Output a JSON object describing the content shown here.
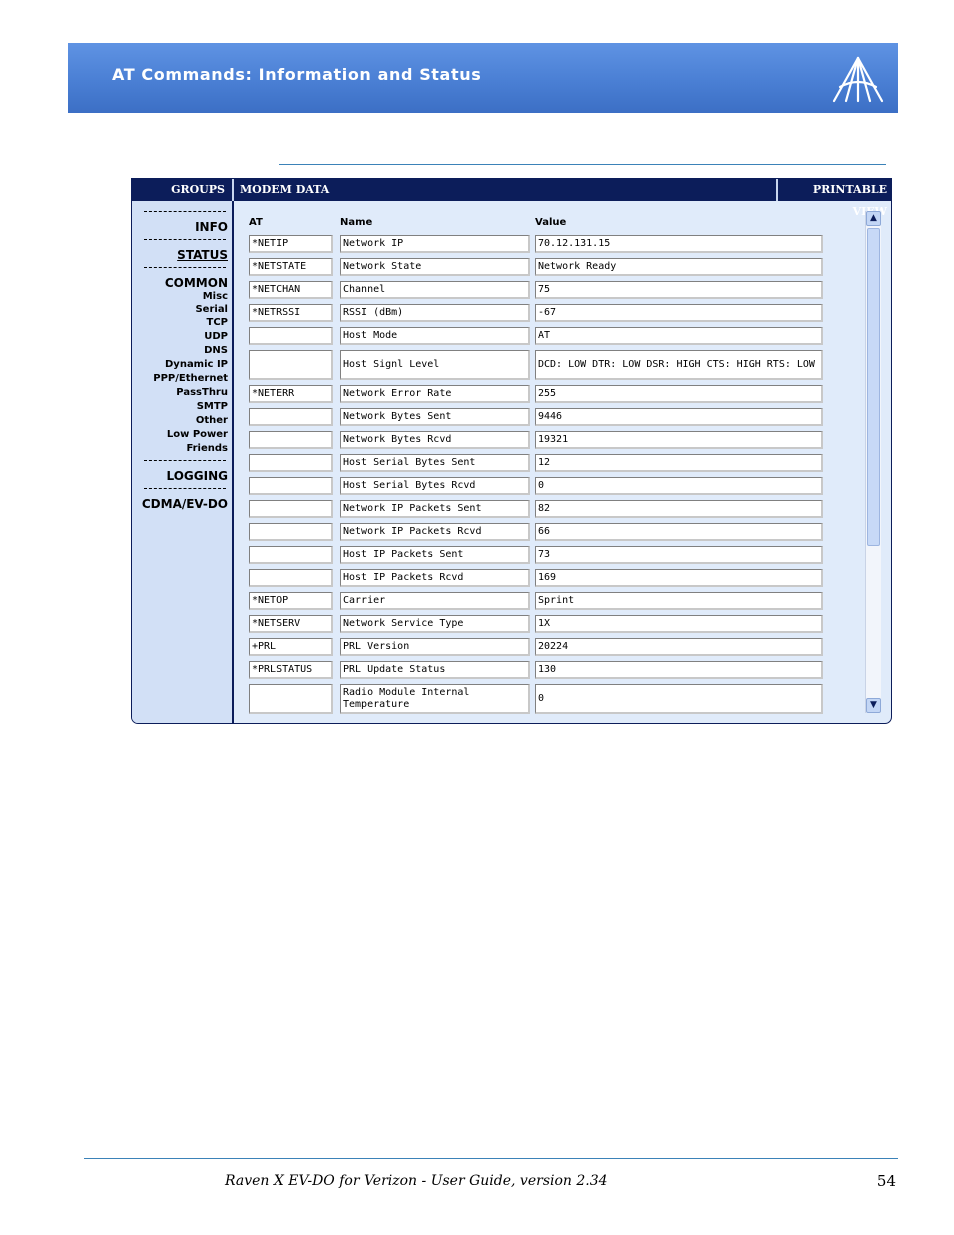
{
  "header": {
    "title": "AT Commands: Information and Status"
  },
  "topbar": {
    "groups": "GROUPS",
    "modem_data": "MODEM DATA",
    "printable_view": "PRINTABLE VIEW"
  },
  "sidebar": {
    "separator": "--------------",
    "items": [
      {
        "label": "INFO",
        "kind": "group"
      },
      {
        "label": "STATUS",
        "kind": "group-active"
      },
      {
        "label": "COMMON",
        "kind": "group"
      },
      {
        "label": "Misc",
        "kind": "sub"
      },
      {
        "label": "Serial",
        "kind": "sub"
      },
      {
        "label": "TCP",
        "kind": "sub"
      },
      {
        "label": "UDP",
        "kind": "sub"
      },
      {
        "label": "DNS",
        "kind": "sub"
      },
      {
        "label": "Dynamic IP",
        "kind": "sub"
      },
      {
        "label": "PPP/Ethernet",
        "kind": "sub"
      },
      {
        "label": "PassThru",
        "kind": "sub"
      },
      {
        "label": "SMTP",
        "kind": "sub"
      },
      {
        "label": "Other",
        "kind": "sub"
      },
      {
        "label": "Low Power",
        "kind": "sub"
      },
      {
        "label": "Friends",
        "kind": "sub"
      },
      {
        "label": "LOGGING",
        "kind": "group"
      },
      {
        "label": "CDMA/EV-DO",
        "kind": "group"
      }
    ]
  },
  "table": {
    "columns": [
      "AT",
      "Name",
      "Value"
    ],
    "rows": [
      {
        "at": "*NETIP",
        "name": "Network IP",
        "value": "70.12.131.15"
      },
      {
        "at": "*NETSTATE",
        "name": "Network State",
        "value": "Network Ready"
      },
      {
        "at": "*NETCHAN",
        "name": "Channel",
        "value": "75"
      },
      {
        "at": "*NETRSSI",
        "name": "RSSI (dBm)",
        "value": "-67"
      },
      {
        "at": "",
        "name": "Host Mode",
        "value": "AT"
      },
      {
        "at": "",
        "name": "Host Signl Level",
        "value": "DCD: LOW DTR: LOW DSR: HIGH CTS: HIGH RTS: LOW"
      },
      {
        "at": "*NETERR",
        "name": "Network Error Rate",
        "value": "255"
      },
      {
        "at": "",
        "name": "Network Bytes Sent",
        "value": "9446"
      },
      {
        "at": "",
        "name": "Network Bytes Rcvd",
        "value": "19321"
      },
      {
        "at": "",
        "name": "Host Serial Bytes Sent",
        "value": "12"
      },
      {
        "at": "",
        "name": "Host Serial Bytes Rcvd",
        "value": "0"
      },
      {
        "at": "",
        "name": "Network IP Packets Sent",
        "value": "82"
      },
      {
        "at": "",
        "name": "Network IP Packets Rcvd",
        "value": "66"
      },
      {
        "at": "",
        "name": "Host IP Packets Sent",
        "value": "73"
      },
      {
        "at": "",
        "name": "Host IP Packets Rcvd",
        "value": "169"
      },
      {
        "at": "*NETOP",
        "name": "Carrier",
        "value": "Sprint"
      },
      {
        "at": "*NETSERV",
        "name": "Network Service Type",
        "value": "1X"
      },
      {
        "at": "+PRL",
        "name": "PRL Version",
        "value": "20224"
      },
      {
        "at": "*PRLSTATUS",
        "name": "PRL Update Status",
        "value": "130"
      },
      {
        "at": "",
        "name": "Radio Module Internal Temperature",
        "value": "0"
      }
    ]
  },
  "scrollbar": {
    "up_icon": "▲",
    "down_icon": "▼"
  },
  "footer": {
    "text": "Raven X EV-DO for Verizon - User Guide, version 2.34",
    "page_number": "54"
  }
}
